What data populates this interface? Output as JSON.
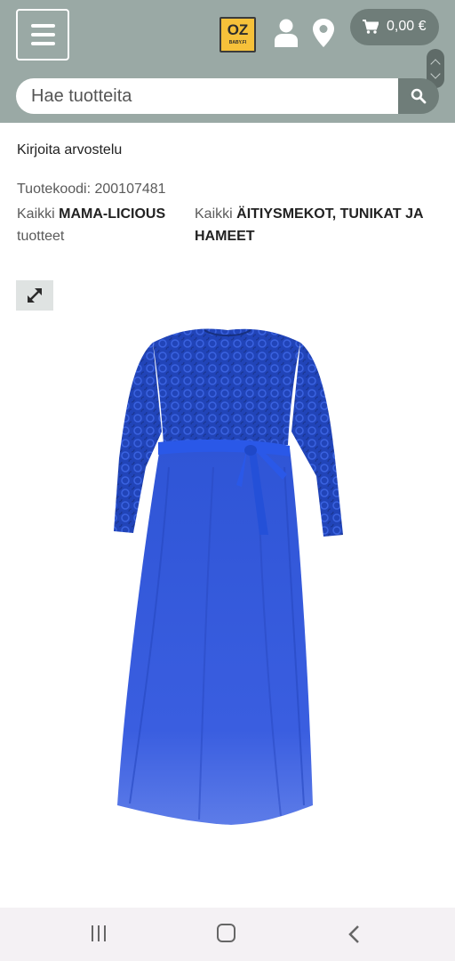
{
  "header": {
    "menu_icon": "hamburger-menu-icon",
    "logo": {
      "main": "OZ",
      "sub": "BABY.FI"
    },
    "user_icon": "user-icon",
    "location_icon": "map-pin-icon",
    "cart": {
      "icon": "shopping-cart-icon",
      "total": "0,00 €"
    },
    "search": {
      "placeholder": "Hae tuotteita",
      "value": "",
      "icon": "search-icon"
    },
    "colors": {
      "header_bg": "#9aa9a5",
      "button_bg": "#6f7d79",
      "logo_bg": "#f6c13a"
    }
  },
  "product": {
    "review_link": "Kirjoita arvostelu",
    "code_label": "Tuotekoodi:",
    "code_value": "200107481",
    "brand_prefix": "Kaikki",
    "brand_name": "MAMA-LICIOUS",
    "brand_suffix": "tuotteet",
    "category_prefix": "Kaikki",
    "category_name": "ÄITIYSMEKOT, TUNIKAT JA HAMEET",
    "expand_icon": "expand-arrows-icon",
    "image": {
      "subject": "blue lace maternity maxi dress",
      "color": "#2a4fd0"
    }
  },
  "system_nav": {
    "recent_icon": "recent-apps-icon",
    "home_icon": "home-icon",
    "back_icon": "back-icon"
  }
}
